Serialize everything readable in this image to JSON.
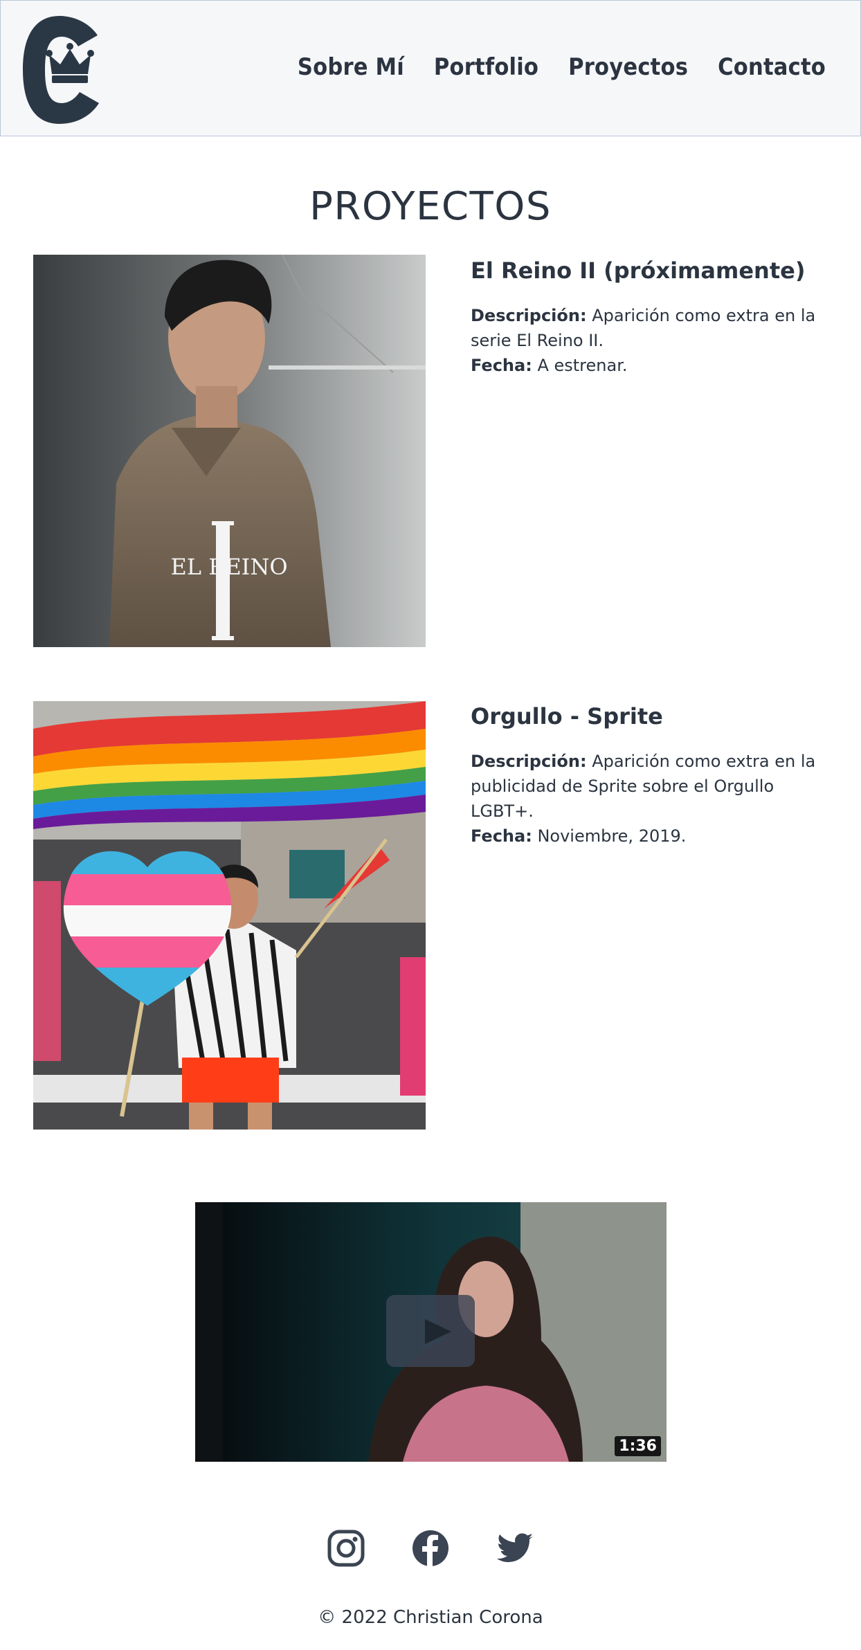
{
  "header": {
    "logo_name": "logo-crown-c",
    "nav": [
      {
        "label": "Sobre Mí"
      },
      {
        "label": "Portfolio"
      },
      {
        "label": "Proyectos"
      },
      {
        "label": "Contacto"
      }
    ]
  },
  "page": {
    "title": "PROYECTOS"
  },
  "projects": [
    {
      "name": "El Reino II (próximamente)",
      "desc_label": "Descripción:",
      "description": " Aparición como extra en la serie El Reino II.",
      "date_label": "Fecha:",
      "date": " A estrenar.",
      "poster_text": "EL REINO"
    },
    {
      "name": "Orgullo - Sprite",
      "desc_label": "Descripción:",
      "description": " Aparición como extra en la publicidad de Sprite sobre el Orgullo LGBT+.",
      "date_label": "Fecha:",
      "date": " Noviembre, 2019."
    }
  ],
  "video": {
    "duration": "1:36",
    "icon": "play-icon"
  },
  "social": [
    {
      "name": "instagram-icon"
    },
    {
      "name": "facebook-icon"
    },
    {
      "name": "twitter-icon"
    }
  ],
  "footer": {
    "copyright": "© 2022 Christian Corona"
  },
  "colors": {
    "text": "#2b3440",
    "header_bg": "#f6f7f9",
    "header_border": "#b9c6d6"
  }
}
